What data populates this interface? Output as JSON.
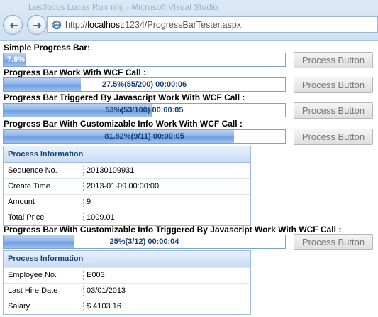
{
  "browser": {
    "window_title": "Lostfocus Lucas Running - Microsoft Visual Studio",
    "url_prefix": "http://",
    "url_host": "localhost",
    "url_rest": ":1234/ProgressBarTester.aspx"
  },
  "sections": [
    {
      "title": "Simple Progress Bar:",
      "progress": 0.078,
      "text": "7.8%",
      "button": "Process Button"
    },
    {
      "title": "Progress Bar Work With WCF Call :",
      "progress": 0.275,
      "text": "27.5%(55/200) 00:00:06",
      "button": "Process Button"
    },
    {
      "title": "Progress Bar Triggered By Javascript Work With WCF Call :",
      "progress": 0.53,
      "text": "53%(53/100) 00:00:05",
      "button": "Process Button"
    },
    {
      "title": "Progress Bar With Customizable Info Work With WCF Call :",
      "progress": 0.8182,
      "text": "81.82%(9/11) 00:00:05",
      "button": "Process Button"
    },
    {
      "title": "Progress Bar With Customizable Info Triggered By Javascript Work With WCF Call :",
      "progress": 0.25,
      "text": "25%(3/12) 00:00:04",
      "button": "Process Button"
    }
  ],
  "panel1": {
    "header": "Process Information",
    "rows": [
      {
        "label": "Sequence No.",
        "value": "20130109931"
      },
      {
        "label": "Create Time",
        "value": "2013-01-09 00:00:00"
      },
      {
        "label": "Amount",
        "value": "9"
      },
      {
        "label": "Total Price",
        "value": "1009.01"
      }
    ]
  },
  "panel2": {
    "header": "Process Information",
    "rows": [
      {
        "label": "Employee No.",
        "value": "E003"
      },
      {
        "label": "Last Hire Date",
        "value": "03/01/2013"
      },
      {
        "label": "Salary",
        "value": "$ 4103.16"
      }
    ]
  }
}
